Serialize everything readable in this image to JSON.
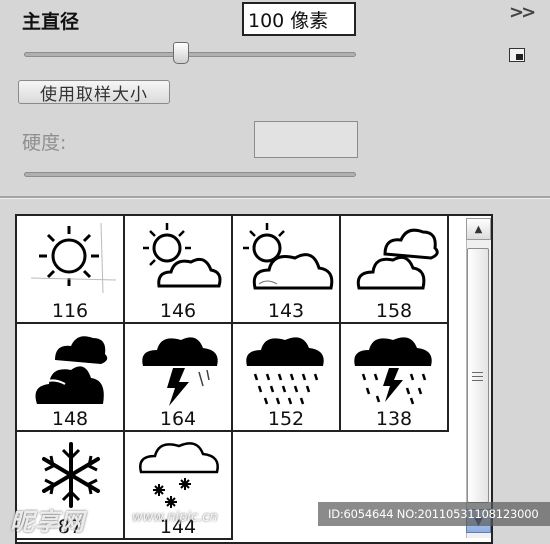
{
  "panel": {
    "diameter_label": "主直径",
    "diameter_value": "100 像素",
    "menu_icon": "double-chevron-right-icon",
    "new_preset_icon": "new-preset-icon",
    "sample_button_label": "使用取样大小",
    "hardness_label": "硬度:",
    "hardness_value": "",
    "diameter_slider_fraction": 0.47
  },
  "brushes": [
    {
      "size": "116",
      "icon": "sun-icon"
    },
    {
      "size": "146",
      "icon": "sun-cloud-icon"
    },
    {
      "size": "143",
      "icon": "sun-cloud-outline-icon"
    },
    {
      "size": "158",
      "icon": "two-clouds-outline-icon"
    },
    {
      "size": "148",
      "icon": "dark-clouds-icon"
    },
    {
      "size": "164",
      "icon": "storm-cloud-lightning-icon"
    },
    {
      "size": "152",
      "icon": "rain-cloud-icon"
    },
    {
      "size": "138",
      "icon": "thunderstorm-rain-icon"
    },
    {
      "size": "87",
      "icon": "snowflake-icon"
    },
    {
      "size": "144",
      "icon": "snow-cloud-icon"
    }
  ],
  "watermark": {
    "site_name": "昵享网",
    "url": "www.nipic.cn",
    "id_text": "ID:6054644 NO:20110531108123000"
  },
  "colors": {
    "panel_bg": "#d6d6d6",
    "grid_bg": "#ffffff",
    "scroll_down_accent": "#8eaee0"
  }
}
